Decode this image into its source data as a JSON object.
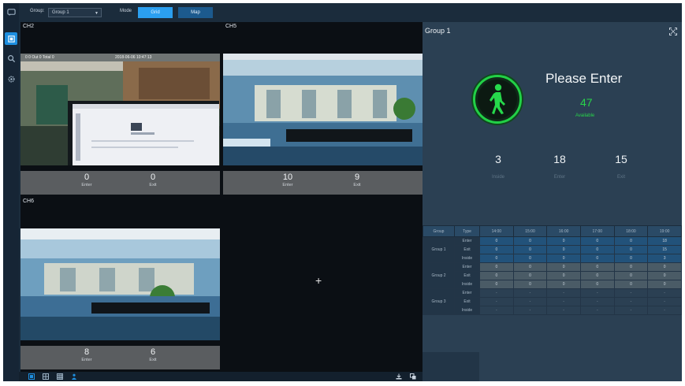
{
  "topbar": {
    "group_label": "Group:",
    "group_value": "Group 1",
    "mode_label": "Mode",
    "mode_options": [
      {
        "label": "Grid",
        "active": true
      },
      {
        "label": "Map",
        "active": false
      }
    ]
  },
  "rail": {
    "items": [
      {
        "icon": "chat-icon",
        "active": false
      },
      {
        "icon": "people-counting-icon",
        "active": true
      },
      {
        "icon": "search-icon",
        "active": false
      },
      {
        "icon": "settings-icon",
        "active": false
      }
    ]
  },
  "cameras": [
    {
      "title": "CH2",
      "osd_left": "0  0 Out  0 Total  0",
      "osd_right": "2018-06-06 10:47:13",
      "enter": "0",
      "exit": "0",
      "enter_label": "Enter",
      "exit_label": "Exit"
    },
    {
      "title": "CH5",
      "enter": "10",
      "exit": "9",
      "enter_label": "Enter",
      "exit_label": "Exit"
    },
    {
      "title": "CH6",
      "enter": "8",
      "exit": "6",
      "enter_label": "Enter",
      "exit_label": "Exit"
    }
  ],
  "empty_cell": {
    "glyph": "+"
  },
  "panel": {
    "title": "Group 1",
    "status": "Please Enter",
    "available": "47",
    "available_label": "Available",
    "stats": [
      {
        "value": "3",
        "label": "Inside"
      },
      {
        "value": "18",
        "label": "Enter"
      },
      {
        "value": "15",
        "label": "Exit"
      }
    ]
  },
  "table": {
    "headers": [
      "Group",
      "Type",
      "14:00",
      "15:00",
      "16:00",
      "17:00",
      "18:00",
      "19:00"
    ],
    "groups": [
      {
        "name": "Group 1",
        "rows": [
          {
            "type": "Enter",
            "values": [
              "0",
              "0",
              "0",
              "0",
              "0",
              "18"
            ]
          },
          {
            "type": "Exit",
            "values": [
              "0",
              "0",
              "0",
              "0",
              "0",
              "15"
            ]
          },
          {
            "type": "Inside",
            "values": [
              "0",
              "0",
              "0",
              "0",
              "0",
              "3"
            ]
          }
        ]
      },
      {
        "name": "Group 2",
        "rows": [
          {
            "type": "Enter",
            "values": [
              "0",
              "0",
              "0",
              "0",
              "0",
              "0"
            ]
          },
          {
            "type": "Exit",
            "values": [
              "0",
              "0",
              "0",
              "0",
              "0",
              "0"
            ]
          },
          {
            "type": "Inside",
            "values": [
              "0",
              "0",
              "0",
              "0",
              "0",
              "0"
            ]
          }
        ]
      },
      {
        "name": "Group 3",
        "rows": [
          {
            "type": "Enter",
            "values": [
              "-",
              "-",
              "-",
              "-",
              "-",
              "-"
            ]
          },
          {
            "type": "Exit",
            "values": [
              "-",
              "-",
              "-",
              "-",
              "-",
              "-"
            ]
          },
          {
            "type": "Inside",
            "values": [
              "-",
              "-",
              "-",
              "-",
              "-",
              "-"
            ]
          }
        ]
      }
    ]
  },
  "colors": {
    "accent": "#1e8fe0",
    "available_green": "#28d24a",
    "background": "#1b2c3c"
  }
}
